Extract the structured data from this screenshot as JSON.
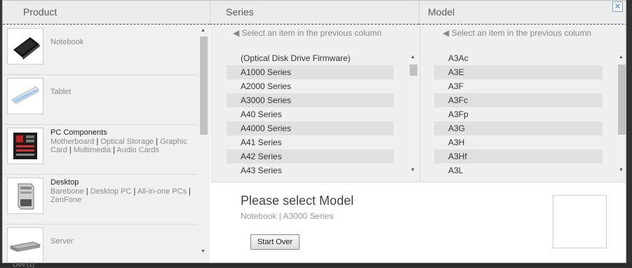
{
  "headers": {
    "product": "Product",
    "series": "Series",
    "model": "Model"
  },
  "close_icon": "close-icon",
  "products": [
    {
      "name": "Notebook",
      "icon": "notebook-icon",
      "subs": []
    },
    {
      "name": "Tablet",
      "icon": "tablet-icon",
      "subs": []
    },
    {
      "name": "PC Components",
      "icon": "motherboard-icon",
      "subs": [
        "Motherboard",
        "Optical Storage",
        "Graphic Card",
        "Multimedia",
        "Audio Cards"
      ]
    },
    {
      "name": "Desktop",
      "icon": "desktop-tower-icon",
      "subs": [
        "Barebone",
        "Desktop PC",
        "All-in-one PCs",
        "ZenFone"
      ]
    },
    {
      "name": "Server",
      "icon": "server-icon",
      "subs": []
    }
  ],
  "series": {
    "hint": "◀ Select an item in the previous column",
    "items": [
      "(Optical Disk Drive Firmware)",
      "A1000 Series",
      "A2000 Series",
      "A3000 Series",
      "A40 Series",
      "A4000 Series",
      "A41 Series",
      "A42 Series",
      "A43 Series"
    ]
  },
  "model": {
    "hint": "◀ Select an item in the previous column",
    "items": [
      "A3Ac",
      "A3E",
      "A3F",
      "A3Fc",
      "A3Fp",
      "A3G",
      "A3H",
      "A3Hf",
      "A3L"
    ]
  },
  "info": {
    "title": "Please select Model",
    "subtitle": "Notebook | A3000 Series",
    "start_over": "Start Over"
  },
  "footer_fragment": "LAN (1)"
}
